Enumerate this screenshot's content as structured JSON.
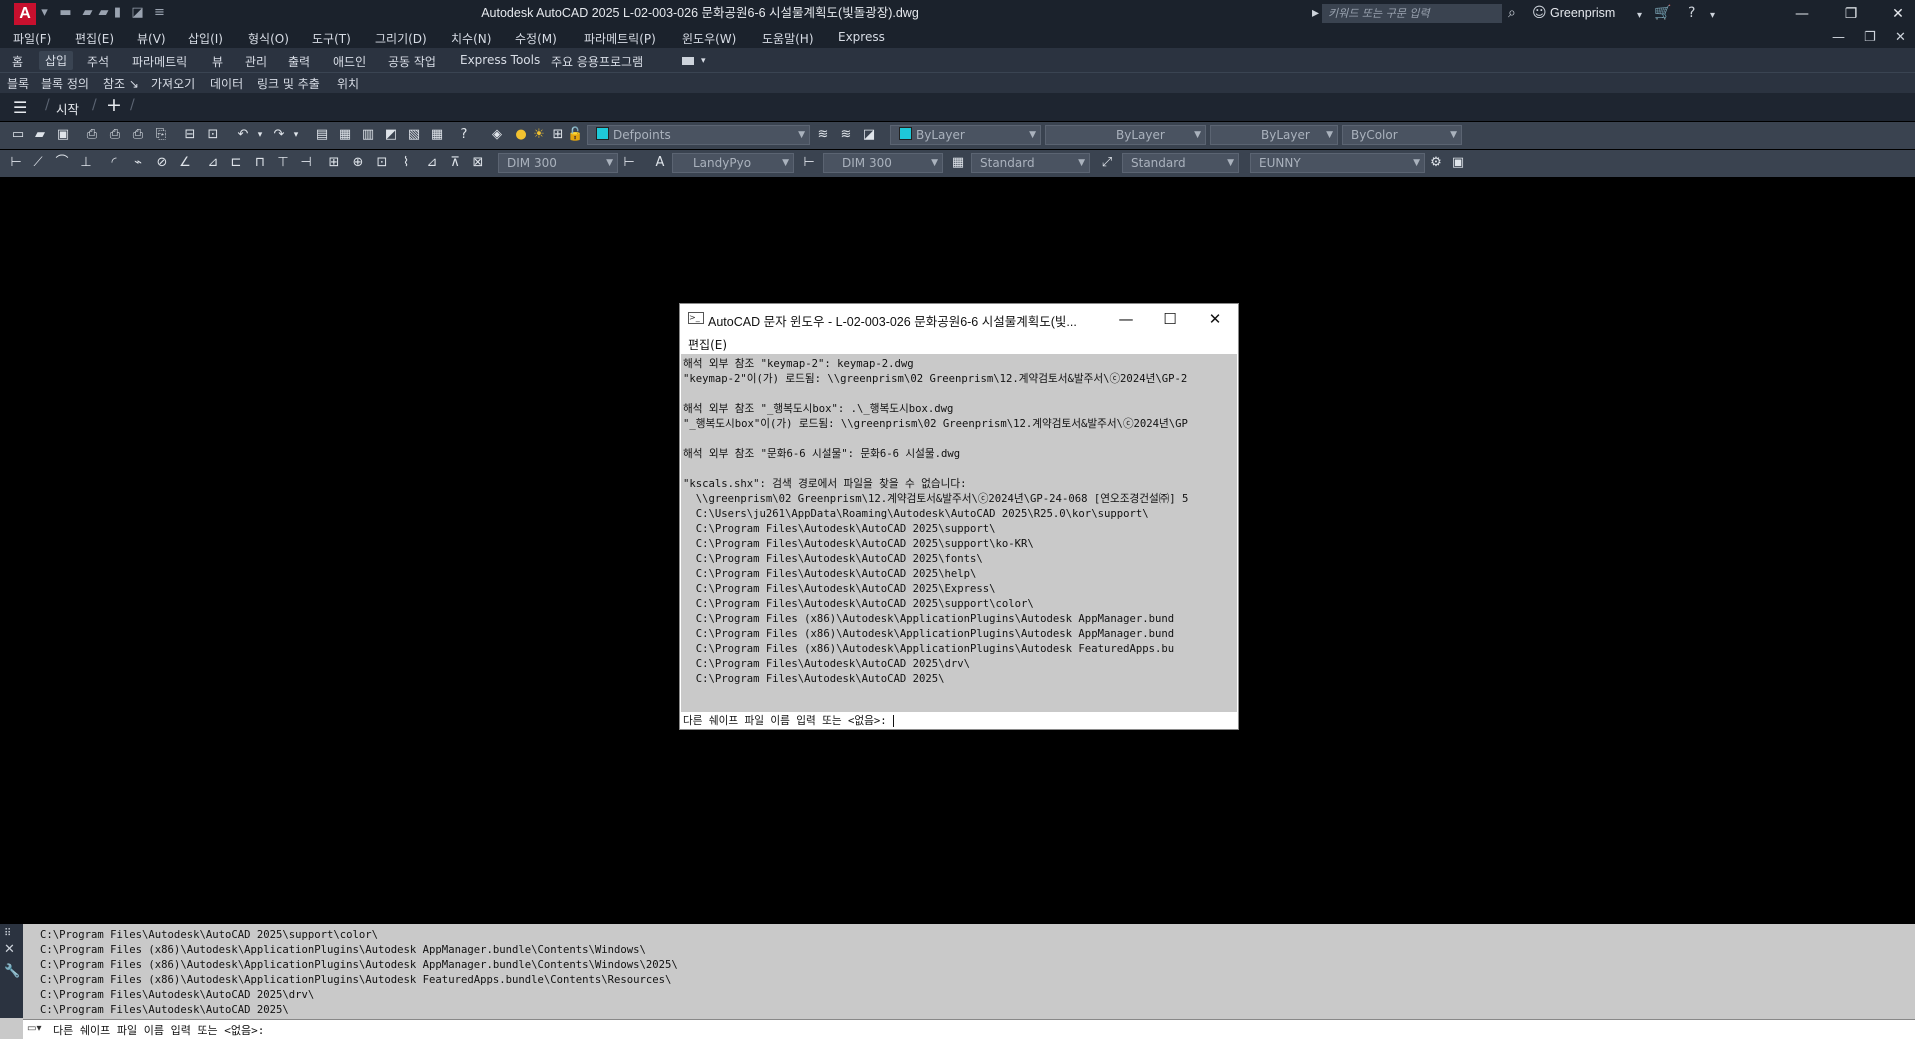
{
  "titlebar": {
    "logo": "A",
    "title": "Autodesk AutoCAD 2025    L-02-003-026 문화공원6-6 시설물계획도(빛돌광장).dwg",
    "search_placeholder": "키워드 또는 구문 입력",
    "user": "Greenprism"
  },
  "menu": [
    "파일(F)",
    "편집(E)",
    "뷰(V)",
    "삽입(I)",
    "형식(O)",
    "도구(T)",
    "그리기(D)",
    "치수(N)",
    "수정(M)",
    "파라메트릭(P)",
    "윈도우(W)",
    "도움말(H)",
    "Express"
  ],
  "ribbon_tabs": [
    "홈",
    "삽입",
    "주석",
    "파라메트릭",
    "뷰",
    "관리",
    "출력",
    "애드인",
    "공동 작업",
    "Express Tools",
    "주요 응용프로그램"
  ],
  "ribbon_active_tab": "삽입",
  "ribbon_panels": [
    "블록",
    "블록 정의",
    "참조 ↘",
    "가져오기",
    "데이터",
    "링크 및 추출",
    "위치"
  ],
  "file_tabs": {
    "start": "시작"
  },
  "toolbar1": {
    "layer": "Defpoints",
    "color": "ByLayer",
    "linetype": "ByLayer",
    "lineweight": "ByLayer",
    "plotstyle": "ByColor"
  },
  "toolbar2": {
    "dimstyle": "DIM 300",
    "textstyle": "LandyPyo",
    "dimstyle2": "DIM 300",
    "tablestyle": "Standard",
    "mleaderstyle": "Standard",
    "named": "EUNNY"
  },
  "text_window": {
    "title": "AutoCAD 문자 윈도우 - L-02-003-026 문화공원6-6 시설물계획도(빛...",
    "menu": "편집(E)",
    "lines": [
      "해석 외부 참조 \"keymap-2\": keymap-2.dwg",
      "\"keymap-2\"이(가) 로드됨: \\\\greenprism\\02 Greenprism\\12.계약검토서&발주서\\ⓒ2024년\\GP-2",
      "",
      "해석 외부 참조 \"_행복도시box\": .\\_행복도시box.dwg",
      "\"_행복도시box\"이(가) 로드됨: \\\\greenprism\\02 Greenprism\\12.계약검토서&발주서\\ⓒ2024년\\GP",
      "",
      "해석 외부 참조 \"문화6-6 시설물\": 문화6-6 시설물.dwg",
      "",
      "\"kscals.shx\": 검색 경로에서 파일을 찾을 수 없습니다:",
      "  \\\\greenprism\\02 Greenprism\\12.계약검토서&발주서\\ⓒ2024년\\GP-24-068 [연오조경건설㈜] 5",
      "  C:\\Users\\ju261\\AppData\\Roaming\\Autodesk\\AutoCAD 2025\\R25.0\\kor\\support\\",
      "  C:\\Program Files\\Autodesk\\AutoCAD 2025\\support\\",
      "  C:\\Program Files\\Autodesk\\AutoCAD 2025\\support\\ko-KR\\",
      "  C:\\Program Files\\Autodesk\\AutoCAD 2025\\fonts\\",
      "  C:\\Program Files\\Autodesk\\AutoCAD 2025\\help\\",
      "  C:\\Program Files\\Autodesk\\AutoCAD 2025\\Express\\",
      "  C:\\Program Files\\Autodesk\\AutoCAD 2025\\support\\color\\",
      "  C:\\Program Files (x86)\\Autodesk\\ApplicationPlugins\\Autodesk AppManager.bund",
      "  C:\\Program Files (x86)\\Autodesk\\ApplicationPlugins\\Autodesk AppManager.bund",
      "  C:\\Program Files (x86)\\Autodesk\\ApplicationPlugins\\Autodesk FeaturedApps.bu",
      "  C:\\Program Files\\Autodesk\\AutoCAD 2025\\drv\\",
      "  C:\\Program Files\\Autodesk\\AutoCAD 2025\\"
    ],
    "input": "다른 쉐이프 파일 이름 입력 또는 <없음>: "
  },
  "command_line": {
    "lines": [
      "C:\\Program Files\\Autodesk\\AutoCAD 2025\\support\\color\\",
      "C:\\Program Files (x86)\\Autodesk\\ApplicationPlugins\\Autodesk AppManager.bundle\\Contents\\Windows\\",
      "C:\\Program Files (x86)\\Autodesk\\ApplicationPlugins\\Autodesk AppManager.bundle\\Contents\\Windows\\2025\\",
      "C:\\Program Files (x86)\\Autodesk\\ApplicationPlugins\\Autodesk FeaturedApps.bundle\\Contents\\Resources\\",
      "C:\\Program Files\\Autodesk\\AutoCAD 2025\\drv\\",
      "C:\\Program Files\\Autodesk\\AutoCAD 2025\\"
    ],
    "prompt": "다른 쉐이프 파일 이름 입력 또는 <없음>:"
  },
  "colors": {
    "accent_logo": "#c8102e",
    "layer_swatch": "#1ec8d8",
    "color_swatch": "#1ec8d8",
    "titlebar": "#1b222c",
    "toolbar": "#3a4350",
    "cmd_bg": "#c9c9c9"
  },
  "icons": [
    "new-icon",
    "open-icon",
    "save-icon",
    "plot-icon",
    "undo-icon",
    "redo-icon",
    "help-icon",
    "search-icon",
    "user-icon",
    "cart-icon",
    "minimize-icon",
    "maximize-icon",
    "close-icon"
  ]
}
